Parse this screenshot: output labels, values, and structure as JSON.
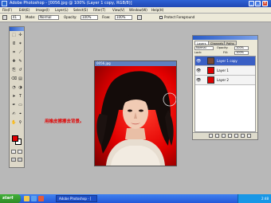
{
  "app": {
    "title": "Adobe Photoshop - [0056.jpg @ 100% (Layer 1 copy, RGB/8)]",
    "window_controls": {
      "minimize": "_",
      "maximize": "□",
      "close": "×"
    }
  },
  "menubar": {
    "items": [
      "File(F)",
      "Edit(E)",
      "Image(I)",
      "Layer(L)",
      "Select(S)",
      "Filter(T)",
      "View(V)",
      "Window(W)",
      "Help(H)"
    ]
  },
  "options": {
    "size_value": "41",
    "mode_label": "Mode:",
    "mode_value": "Normal",
    "opacity_label": "Opacity:",
    "opacity_value": "100%",
    "flow_label": "Flow:",
    "flow_value": "100%",
    "checkbox_label": "Protect Foreground"
  },
  "colors": {
    "foreground": "#e00000",
    "background": "#ffffff",
    "accent": "#3a5fc4"
  },
  "toolbox": {
    "tools": [
      {
        "icon": "⬚",
        "name": "marquee-tool-icon"
      },
      {
        "icon": "✢",
        "name": "move-tool-icon"
      },
      {
        "icon": "ᘓ",
        "name": "lasso-tool-icon"
      },
      {
        "icon": "✶",
        "name": "magic-wand-tool-icon"
      },
      {
        "icon": "⌗",
        "name": "crop-tool-icon"
      },
      {
        "icon": "⟋",
        "name": "slice-tool-icon"
      },
      {
        "icon": "✚",
        "name": "healing-brush-tool-icon"
      },
      {
        "icon": "✎",
        "name": "brush-tool-icon"
      },
      {
        "icon": "⎘",
        "name": "clone-stamp-tool-icon"
      },
      {
        "icon": "↺",
        "name": "history-brush-tool-icon"
      },
      {
        "icon": "⌫",
        "name": "eraser-tool-icon"
      },
      {
        "icon": "▤",
        "name": "gradient-tool-icon"
      },
      {
        "icon": "◔",
        "name": "blur-tool-icon"
      },
      {
        "icon": "◑",
        "name": "dodge-tool-icon"
      },
      {
        "icon": "➤",
        "name": "path-selection-tool-icon"
      },
      {
        "icon": "T",
        "name": "type-tool-icon"
      },
      {
        "icon": "✒",
        "name": "pen-tool-icon"
      },
      {
        "icon": "▭",
        "name": "shape-tool-icon"
      },
      {
        "icon": "✍",
        "name": "notes-tool-icon"
      },
      {
        "icon": "⌖",
        "name": "eyedropper-tool-icon"
      },
      {
        "icon": "✋",
        "name": "hand-tool-icon"
      },
      {
        "icon": "⚲",
        "name": "zoom-tool-icon"
      }
    ]
  },
  "document": {
    "title": "0056.jpg"
  },
  "annotation": {
    "text": "用橡皮擦擦去背景。"
  },
  "layers_panel": {
    "tabs": [
      "Layers",
      "Channels",
      "Paths"
    ],
    "blend_mode": "Normal",
    "opacity_label": "Opacity:",
    "opacity_value": "100%",
    "lock_label": "Lock:",
    "fill_label": "Fill:",
    "fill_value": "100%",
    "layers": [
      {
        "name": "Layer 1 copy",
        "selected": true,
        "thumb": "#7a4a35",
        "eye": "👁"
      },
      {
        "name": "Layer 1",
        "selected": false,
        "thumb": "#e00000",
        "eye": "👁"
      },
      {
        "name": "Layer 2",
        "selected": false,
        "thumb": "#e00000",
        "eye": "👁"
      }
    ]
  },
  "taskbar": {
    "start_label": "start",
    "task_button": "Adobe Photoshop - [",
    "clock": "2:48"
  }
}
